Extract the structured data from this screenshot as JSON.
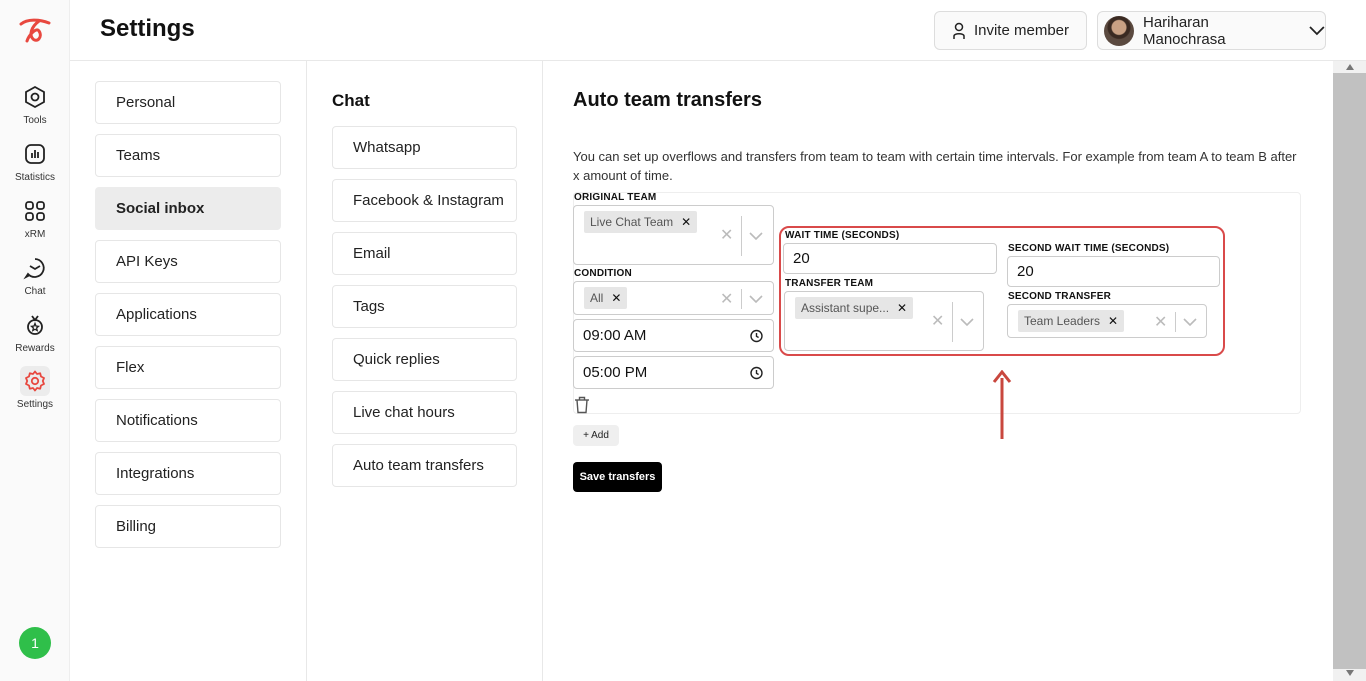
{
  "header": {
    "title": "Settings",
    "invite_label": "Invite member",
    "user_name": "Hariharan Manochrasa"
  },
  "rail": {
    "items": [
      {
        "label": "Tools",
        "icon": "tools-hexagon-icon"
      },
      {
        "label": "Statistics",
        "icon": "statistics-chart-icon"
      },
      {
        "label": "xRM",
        "icon": "xrm-grid-icon"
      },
      {
        "label": "Chat",
        "icon": "chat-bubble-icon"
      },
      {
        "label": "Rewards",
        "icon": "rewards-badge-icon"
      },
      {
        "label": "Settings",
        "icon": "gear-icon"
      }
    ],
    "notification_count": "1",
    "accent_color": "#e8483f"
  },
  "settings_menu": {
    "items": [
      "Personal",
      "Teams",
      "Social inbox",
      "API Keys",
      "Applications",
      "Flex",
      "Notifications",
      "Integrations",
      "Billing"
    ],
    "active": "Social inbox"
  },
  "chat_menu": {
    "title": "Chat",
    "items": [
      "Whatsapp",
      "Facebook & Instagram",
      "Email",
      "Tags",
      "Quick replies",
      "Live chat hours",
      "Auto team transfers"
    ]
  },
  "content": {
    "title": "Auto team transfers",
    "description": "You can set up overflows and transfers from team to team with certain time intervals. For example from team A to team B after x amount of time.",
    "original_team_label": "ORIGINAL TEAM",
    "original_team_chip": "Live Chat Team",
    "condition_label": "CONDITION",
    "condition_chip": "All",
    "time_start": "09:00 AM",
    "time_end": "05:00 PM",
    "wait_time_label": "WAIT TIME (SECONDS)",
    "wait_time_value": "20",
    "transfer_team_label": "TRANSFER TEAM",
    "transfer_team_chip": "Assistant supe...",
    "second_wait_label": "SECOND WAIT TIME (SECONDS)",
    "second_wait_value": "20",
    "second_transfer_label": "SECOND TRANSFER",
    "second_transfer_chip": "Team Leaders",
    "add_label": "+ Add",
    "save_label": "Save transfers",
    "highlight_color": "#d94a4a"
  }
}
